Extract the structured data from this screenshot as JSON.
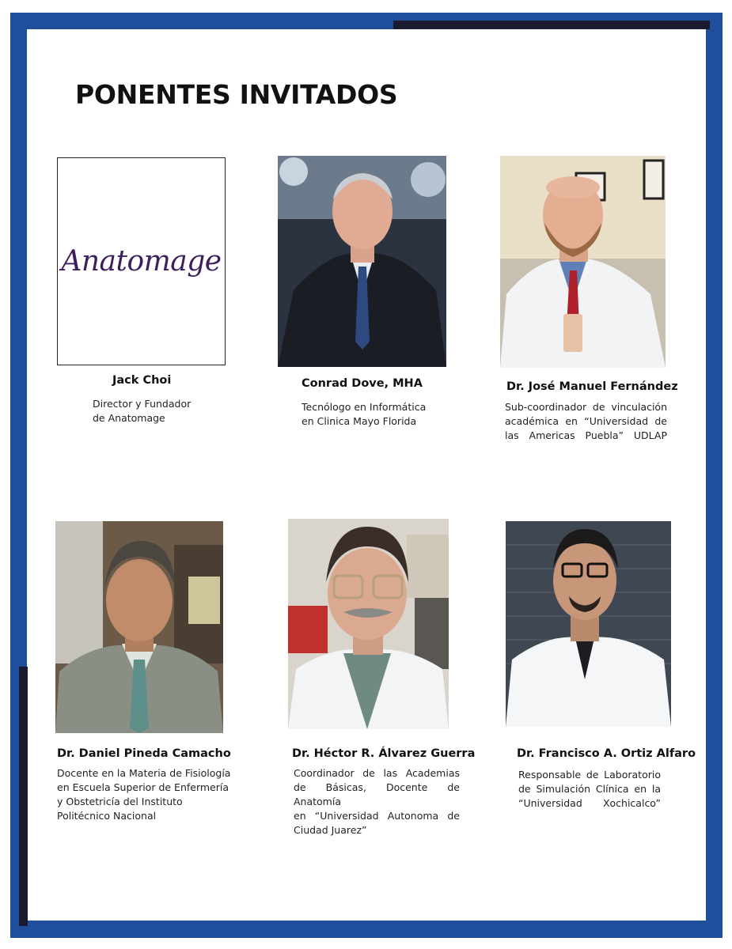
{
  "title": "PONENTES INVITADOS",
  "colors": {
    "frame": "#1f4e9c",
    "accent": "#1a1a30",
    "logo": "#3d1f5c"
  },
  "speakers": [
    {
      "logo": "Anatomage",
      "name": "Jack Choi",
      "role": [
        "Director y Fundador",
        "de Anatomage"
      ]
    },
    {
      "name": "Conrad Dove, MHA",
      "role": [
        "Tecnólogo en Informática",
        "en Clinica Mayo Florida"
      ]
    },
    {
      "name": "Dr. José Manuel Fernández",
      "role": [
        "Sub-coordinador de vinculación",
        "académica en “Universidad de",
        "las Americas Puebla” UDLAP"
      ]
    },
    {
      "name": "Dr. Daniel Pineda Camacho",
      "role": [
        "Docente en la Materia de Fisiología",
        "en Escuela Superior de Enfermería",
        "y Obstetricía del Instituto",
        "Politécnico Nacional"
      ]
    },
    {
      "name": "Dr. Héctor R. Álvarez Guerra",
      "role": [
        "Coordinador de las Academias",
        "de Básicas, Docente de Anatomía",
        "en “Universidad Autonoma de",
        "Ciudad Juarez”"
      ]
    },
    {
      "name": "Dr. Francisco A. Ortiz Alfaro",
      "role": [
        "Responsable de Laboratorio",
        "de Simulación Clínica en la",
        "“Universidad Xochicalco”"
      ]
    }
  ]
}
